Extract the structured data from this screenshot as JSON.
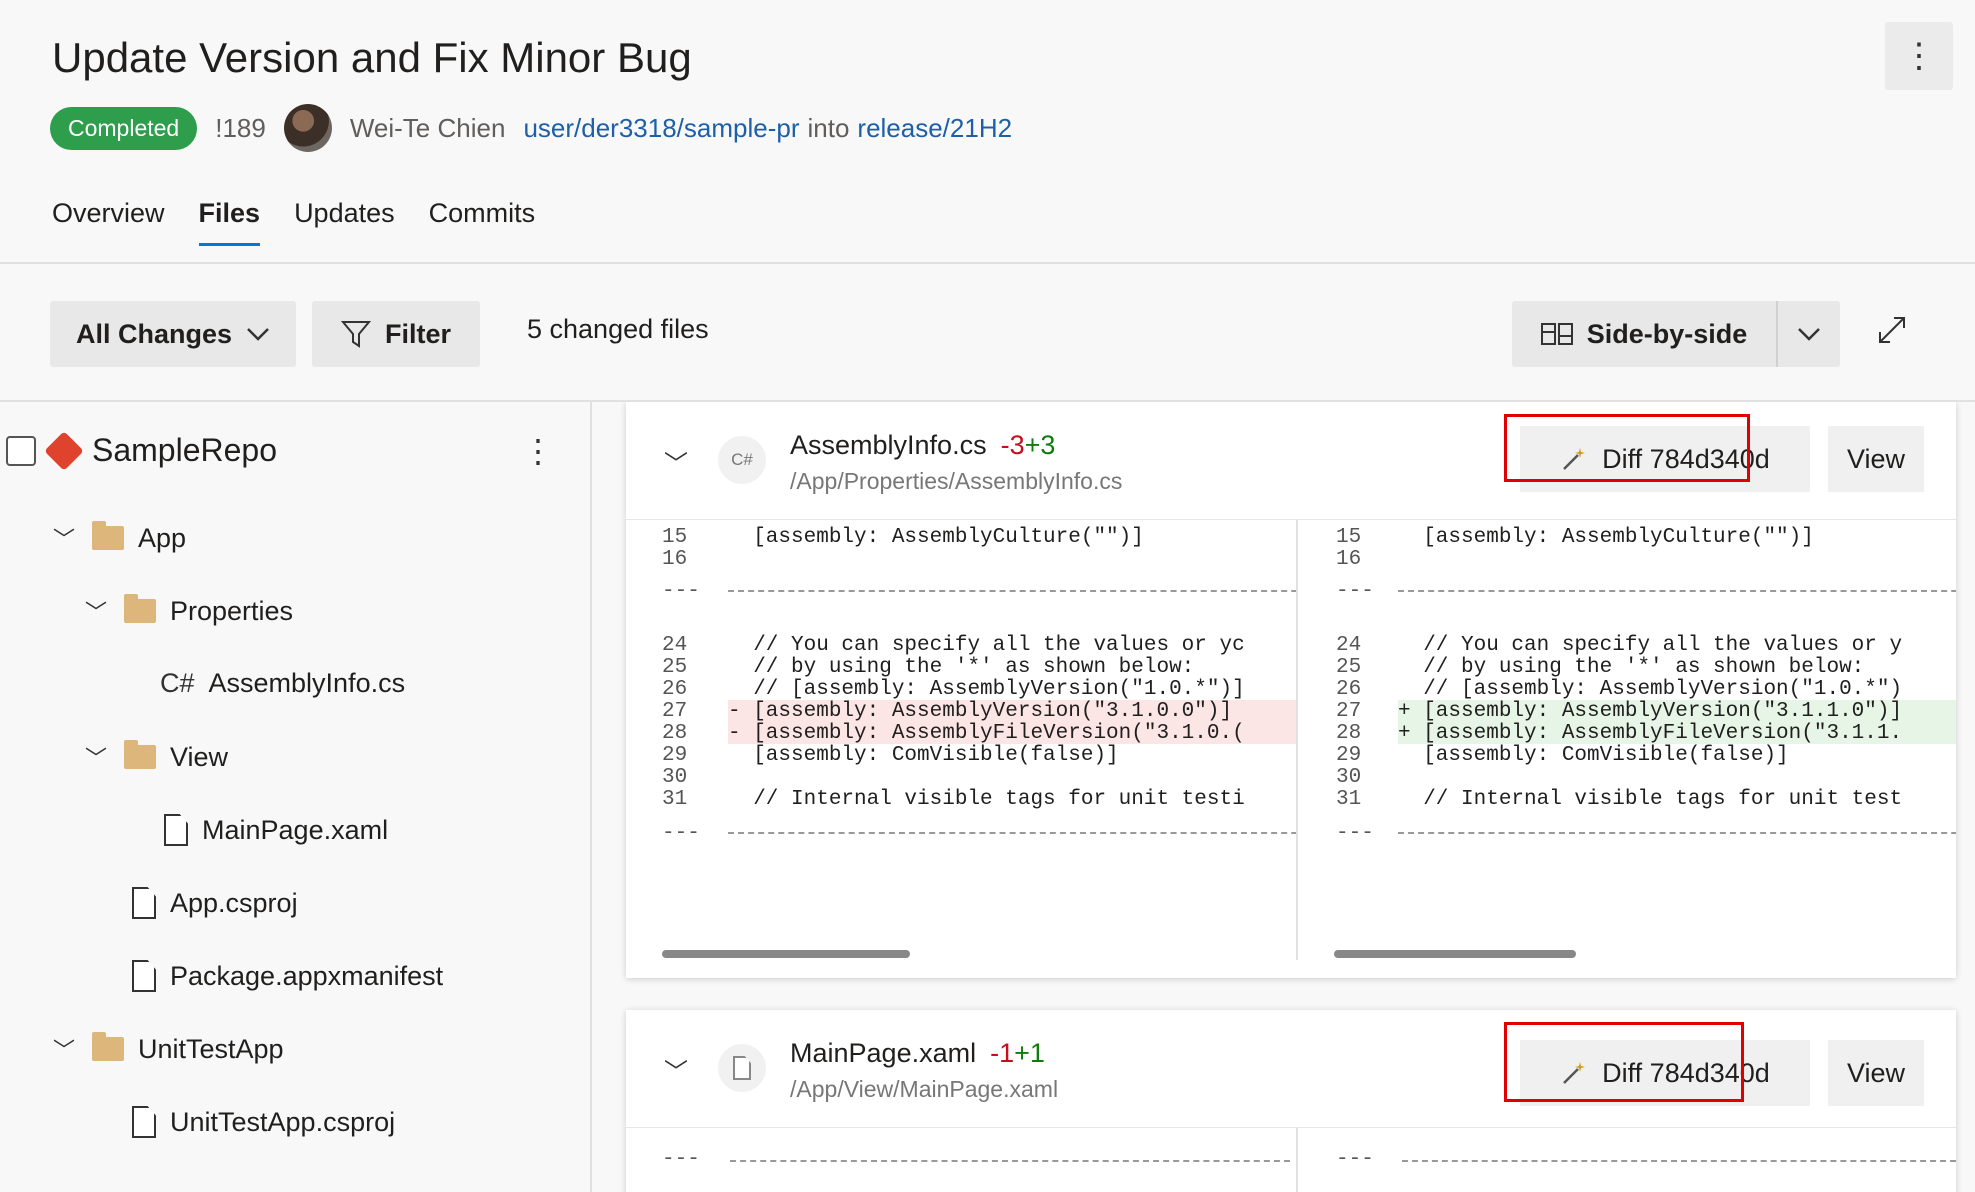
{
  "header": {
    "title": "Update Version and Fix Minor Bug",
    "more_label": "⋮",
    "status": "Completed",
    "pr_id": "!189",
    "author": "Wei-Te Chien",
    "source_branch": "user/der3318/sample-pr",
    "into": "into",
    "target_branch": "release/21H2",
    "tabs": [
      "Overview",
      "Files",
      "Updates",
      "Commits"
    ],
    "active_tab": "Files"
  },
  "toolbar": {
    "all_changes": "All Changes",
    "filter": "Filter",
    "changed_files": "5 changed files",
    "view_mode": "Side-by-side"
  },
  "tree": {
    "repo": "SampleRepo",
    "items": [
      {
        "label": "App",
        "type": "folder"
      },
      {
        "label": "Properties",
        "type": "folder"
      },
      {
        "label": "AssemblyInfo.cs",
        "type": "cs",
        "prefix": "C#"
      },
      {
        "label": "View",
        "type": "folder"
      },
      {
        "label": "MainPage.xaml",
        "type": "file"
      },
      {
        "label": "App.csproj",
        "type": "file"
      },
      {
        "label": "Package.appxmanifest",
        "type": "file"
      },
      {
        "label": "UnitTestApp",
        "type": "folder"
      },
      {
        "label": "UnitTestApp.csproj",
        "type": "file"
      }
    ]
  },
  "files": [
    {
      "name": "AssemblyInfo.cs",
      "lang": "C#",
      "deletions": "-3",
      "additions": "+3",
      "path": "/App/Properties/AssemblyInfo.cs",
      "diff_label": "Diff 784d340d",
      "view_label": "View",
      "separator_label": "---",
      "left": [
        {
          "n": "15",
          "t": "  [assembly: AssemblyCulture(\"\")]"
        },
        {
          "n": "16",
          "t": ""
        },
        {
          "n": "24",
          "t": "  // You can specify all the values or yc"
        },
        {
          "n": "25",
          "t": "  // by using the '*' as shown below:"
        },
        {
          "n": "26",
          "t": "  // [assembly: AssemblyVersion(\"1.0.*\")]"
        },
        {
          "n": "27",
          "t": "- [assembly: AssemblyVersion(\"3.1.0.0\")]"
        },
        {
          "n": "28",
          "t": "- [assembly: AssemblyFileVersion(\"3.1.0.("
        },
        {
          "n": "29",
          "t": "  [assembly: ComVisible(false)]"
        },
        {
          "n": "30",
          "t": ""
        },
        {
          "n": "31",
          "t": "  // Internal visible tags for unit testi"
        }
      ],
      "right": [
        {
          "n": "15",
          "t": "  [assembly: AssemblyCulture(\"\")]"
        },
        {
          "n": "16",
          "t": ""
        },
        {
          "n": "24",
          "t": "  // You can specify all the values or y"
        },
        {
          "n": "25",
          "t": "  // by using the '*' as shown below:"
        },
        {
          "n": "26",
          "t": "  // [assembly: AssemblyVersion(\"1.0.*\")"
        },
        {
          "n": "27",
          "t": "+ [assembly: AssemblyVersion(\"3.1.1.0\")]"
        },
        {
          "n": "28",
          "t": "+ [assembly: AssemblyFileVersion(\"3.1.1."
        },
        {
          "n": "29",
          "t": "  [assembly: ComVisible(false)]"
        },
        {
          "n": "30",
          "t": ""
        },
        {
          "n": "31",
          "t": "  // Internal visible tags for unit test"
        }
      ]
    },
    {
      "name": "MainPage.xaml",
      "lang": "",
      "deletions": "-1",
      "additions": "+1",
      "path": "/App/View/MainPage.xaml",
      "diff_label": "Diff 784d340d",
      "view_label": "View",
      "separator_label": "---"
    }
  ],
  "colors": {
    "accent": "#0078d4",
    "completed": "#2e9e4d",
    "highlight_box": "#e00000",
    "deleted": "#c50f1f",
    "added": "#107c10"
  }
}
